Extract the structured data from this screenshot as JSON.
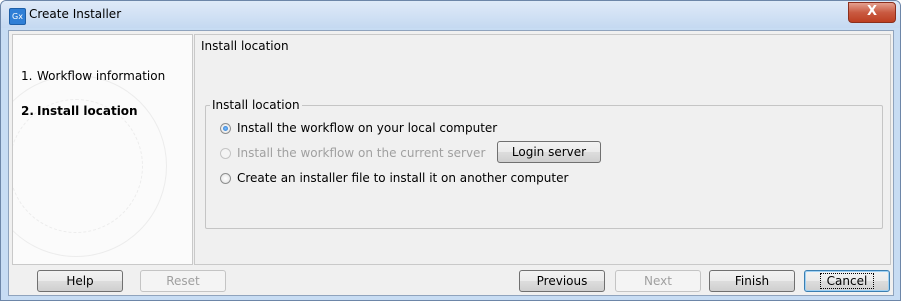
{
  "window": {
    "title": "Create Installer",
    "app_icon_text": "Gx",
    "close_glyph": "X"
  },
  "steps": [
    {
      "num": "1.",
      "label": "Workflow information",
      "active": false
    },
    {
      "num": "2.",
      "label": "Install location",
      "active": true
    }
  ],
  "panel": {
    "heading": "Install location",
    "group_title": "Install location",
    "options": [
      {
        "label": "Install the workflow on your local computer",
        "checked": true,
        "enabled": true
      },
      {
        "label": "Install the workflow on the current server",
        "checked": false,
        "enabled": false
      },
      {
        "label": "Create an installer file to install it on another computer",
        "checked": false,
        "enabled": true
      }
    ],
    "login_button": "Login server"
  },
  "footer": {
    "help": "Help",
    "reset": "Reset",
    "previous": "Previous",
    "next": "Next",
    "finish": "Finish",
    "cancel": "Cancel"
  },
  "icons": {
    "app": "gx-app-icon",
    "close": "close-icon",
    "watermark": "binary-watermark"
  }
}
